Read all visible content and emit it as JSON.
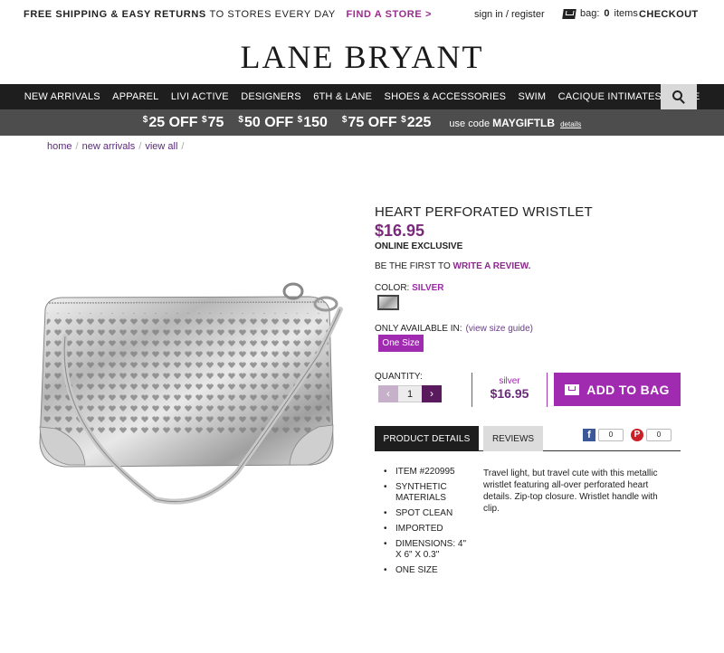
{
  "topbar": {
    "promo_bold": "FREE SHIPPING & EASY RETURNS",
    "promo_light": "TO STORES EVERY DAY",
    "find_store": "FIND A STORE >",
    "signin": "sign in / register",
    "bag_label": "bag:",
    "bag_count": "0",
    "bag_items": "items",
    "checkout": "CHECKOUT"
  },
  "logo": "LANE BRYANT",
  "nav": {
    "items": [
      "NEW ARRIVALS",
      "APPAREL",
      "LIVI ACTIVE",
      "DESIGNERS",
      "6TH & LANE",
      "SHOES & ACCESSORIES",
      "SWIM",
      "CACIQUE INTIMATES",
      "SALE"
    ]
  },
  "offer": {
    "o1_cur": "$",
    "o1_off": "25 OFF",
    "o1_cur2": "$",
    "o1_min": "75",
    "o2_cur": "$",
    "o2_off": "50 OFF",
    "o2_cur2": "$",
    "o2_min": "150",
    "o3_cur": "$",
    "o3_off": "75 OFF",
    "o3_cur2": "$",
    "o3_min": "225",
    "use_code": "use code",
    "code": "MAYGIFTLB",
    "details": "details"
  },
  "breadcrumbs": [
    "home",
    "new arrivals",
    "view all"
  ],
  "breadcrumb_sep": "/",
  "product": {
    "title": "HEART PERFORATED WRISTLET",
    "price": "$16.95",
    "exclusive": "ONLINE EXCLUSIVE",
    "review_prefix": "BE THE FIRST TO",
    "review_link": "WRITE A REVIEW.",
    "color_label": "COLOR:",
    "color_value": "SILVER",
    "avail_label": "ONLY AVAILABLE IN:",
    "size_guide": "(view size guide)",
    "size": "One Size",
    "qty_label": "QUANTITY:",
    "qty_minus": "‹",
    "qty_value": "1",
    "qty_plus": "›",
    "box_color": "silver",
    "box_price": "$16.95",
    "add_to_bag": "ADD TO BAG"
  },
  "tabs": {
    "details": "PRODUCT DETAILS",
    "reviews": "REVIEWS",
    "fb_count": "0",
    "pin_count": "0"
  },
  "details_list": [
    "ITEM #220995",
    "SYNTHETIC MATERIALS",
    "SPOT CLEAN",
    "IMPORTED",
    "DIMENSIONS: 4\" X 6\" X 0.3\"",
    "ONE SIZE"
  ],
  "description": "Travel light, but travel cute with this metallic wristlet featuring all-over perforated heart details. Zip-top closure. Wristlet handle with clip.",
  "colors": {
    "accent": "#a02ab0",
    "price": "#7a2a7a",
    "nav_bg": "#1e1e1e",
    "offer_bg": "#4d4d4d"
  }
}
